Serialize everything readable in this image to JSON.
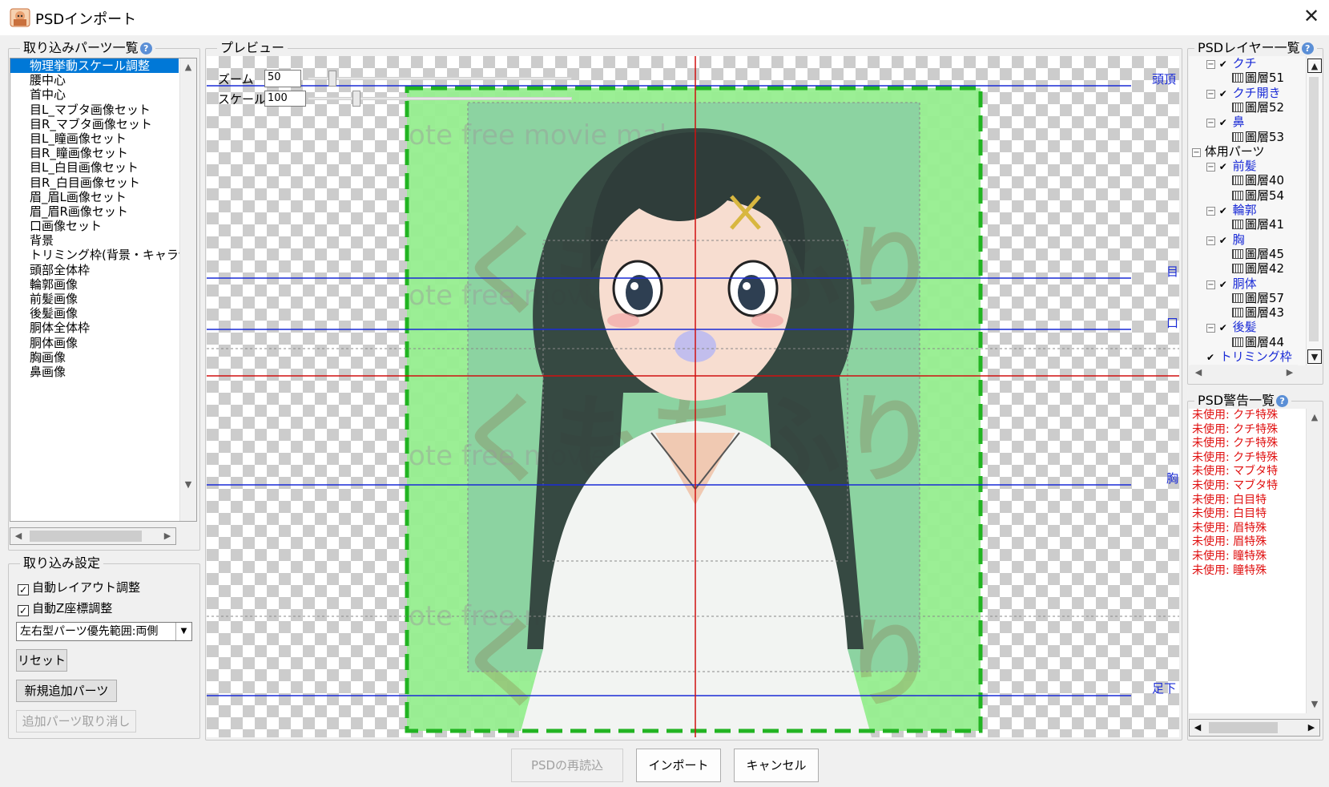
{
  "window": {
    "title": "PSDインポート",
    "close_glyph": "✕"
  },
  "parts_panel": {
    "title": "取り込みパーツ一覧",
    "help": "?",
    "items": [
      "物理挙動スケール調整",
      "腰中心",
      "首中心",
      "目L_マブタ画像セット",
      "目R_マブタ画像セット",
      "目L_瞳画像セット",
      "目R_瞳画像セット",
      "目L_白目画像セット",
      "目R_白目画像セット",
      "眉_眉L画像セット",
      "眉_眉R画像セット",
      "口画像セット",
      "背景",
      "トリミング枠(背景・キャラ切",
      "頭部全体枠",
      "輪郭画像",
      "前髪画像",
      "後髪画像",
      "胴体全体枠",
      "胴体画像",
      "胸画像",
      "鼻画像"
    ]
  },
  "settings_panel": {
    "title": "取り込み設定",
    "auto_layout": {
      "label": "自動レイアウト調整",
      "checked": true
    },
    "auto_z": {
      "label": "自動Z座標調整",
      "checked": true
    },
    "priority_select": "左右型パーツ優先範囲:両側",
    "reset_label": "リセット",
    "add_parts_label": "新規追加パーツ",
    "cancel_add_label": "追加パーツ取り消し"
  },
  "preview_panel": {
    "title": "プレビュー",
    "zoom_label": "ズーム",
    "zoom_value": "50",
    "scale_label": "スケール",
    "scale_value": "100",
    "guides": {
      "top": "頭頂",
      "eye": "目",
      "mouth": "口",
      "chest": "胸",
      "feet": "足下"
    },
    "watermark": "ote free movie mak"
  },
  "layer_panel": {
    "title": "PSDレイヤー一覧",
    "help": "?",
    "rows": [
      {
        "indent": 1,
        "expander": "⊟",
        "check": "✔",
        "label": "クチ",
        "type": "group"
      },
      {
        "indent": 2,
        "label": "圖層51",
        "type": "layer"
      },
      {
        "indent": 1,
        "expander": "⊟",
        "check": "✔",
        "label": "クチ開き",
        "type": "group"
      },
      {
        "indent": 2,
        "label": "圖層52",
        "type": "layer"
      },
      {
        "indent": 1,
        "expander": "⊟",
        "check": "✔",
        "label": "鼻",
        "type": "group"
      },
      {
        "indent": 2,
        "label": "圖層53",
        "type": "layer"
      },
      {
        "indent": 0,
        "expander": "⊟",
        "label": "体用パーツ",
        "type": "folder"
      },
      {
        "indent": 1,
        "expander": "⊟",
        "check": "✔",
        "label": "前髪",
        "type": "group"
      },
      {
        "indent": 2,
        "label": "圖層40",
        "type": "layer"
      },
      {
        "indent": 2,
        "label": "圖層54",
        "type": "layer"
      },
      {
        "indent": 1,
        "expander": "⊟",
        "check": "✔",
        "label": "輪郭",
        "type": "group"
      },
      {
        "indent": 2,
        "label": "圖層41",
        "type": "layer"
      },
      {
        "indent": 1,
        "expander": "⊟",
        "check": "✔",
        "label": "胸",
        "type": "group"
      },
      {
        "indent": 2,
        "label": "圖層45",
        "type": "layer"
      },
      {
        "indent": 2,
        "label": "圖層42",
        "type": "layer"
      },
      {
        "indent": 1,
        "expander": "⊟",
        "check": "✔",
        "label": "胴体",
        "type": "group"
      },
      {
        "indent": 2,
        "label": "圖層57",
        "type": "layer"
      },
      {
        "indent": 2,
        "label": "圖層43",
        "type": "layer"
      },
      {
        "indent": 1,
        "expander": "⊟",
        "check": "✔",
        "label": "後髪",
        "type": "group"
      },
      {
        "indent": 2,
        "label": "圖層44",
        "type": "layer"
      },
      {
        "indent": 1,
        "check": "✔",
        "label": "トリミング枠",
        "type": "group"
      }
    ]
  },
  "warning_panel": {
    "title": "PSD警告一覧",
    "help": "?",
    "items": [
      "未使用: クチ特殊",
      "未使用: クチ特殊",
      "未使用: クチ特殊",
      "未使用: クチ特殊",
      "未使用: マブタ特",
      "未使用: マブタ特",
      "未使用: 白目特",
      "未使用: 白目特",
      "未使用: 眉特殊",
      "未使用: 眉特殊",
      "未使用: 瞳特殊",
      "未使用: 瞳特殊"
    ]
  },
  "footer": {
    "reload_label": "PSDの再読込",
    "import_label": "インポート",
    "cancel_label": "キャンセル"
  },
  "colors": {
    "selection": "#0078d7",
    "guide_blue": "#1a2bd6",
    "guide_red": "#d01010",
    "trim_green": "#22b422",
    "warning_red": "#e01010"
  }
}
